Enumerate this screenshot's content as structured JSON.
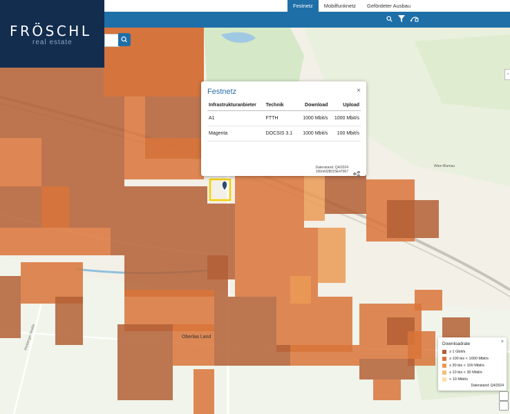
{
  "tabs": [
    {
      "label": "Festnetz",
      "active": true
    },
    {
      "label": "Mobilfunknetz",
      "active": false
    },
    {
      "label": "Gefördeter Ausbau",
      "active": false
    }
  ],
  "logo": {
    "name": "FRÖSCHL",
    "tagline": "real estate"
  },
  "popup": {
    "title": "Festnetz",
    "close": "×",
    "headers": [
      "Infrastrukturanbieter",
      "Technik",
      "Download",
      "Upload"
    ],
    "rows": [
      [
        "A1",
        "FTTH",
        "1000 Mbit/s",
        "1000 Mbit/s"
      ],
      [
        "Magenta",
        "DOCSIS 3.1",
        "1000 Mbit/s",
        "100 Mbit/s"
      ]
    ],
    "stand_line1": "Datenstand: Q4/2024",
    "stand_line2": "100mN28015E47067"
  },
  "legend": {
    "title": "Downloadrate",
    "close": "×",
    "items": [
      {
        "label": "≥ 1 Gbit/s",
        "color": "#b35f35"
      },
      {
        "label": "≥ 100 bis < 1000 Mbit/s",
        "color": "#d9743a"
      },
      {
        "label": "≥ 30 bis < 100 Mbit/s",
        "color": "#ea9a55"
      },
      {
        "label": "≥ 10 bis < 30 Mbit/s",
        "color": "#f3bf7d"
      },
      {
        "label": "< 10 Mbit/s",
        "color": "#fbe0a6"
      }
    ],
    "stand": "Datenstand: Q4/2024"
  },
  "map_labels": {
    "place": "Oberlaa Land",
    "street1": "Himberger Straße",
    "street2": "Wien-Blumau"
  },
  "colors": {
    "primary": "#1e6fa8",
    "logo_bg": "#132d4f",
    "highlight": "#f5d000"
  }
}
